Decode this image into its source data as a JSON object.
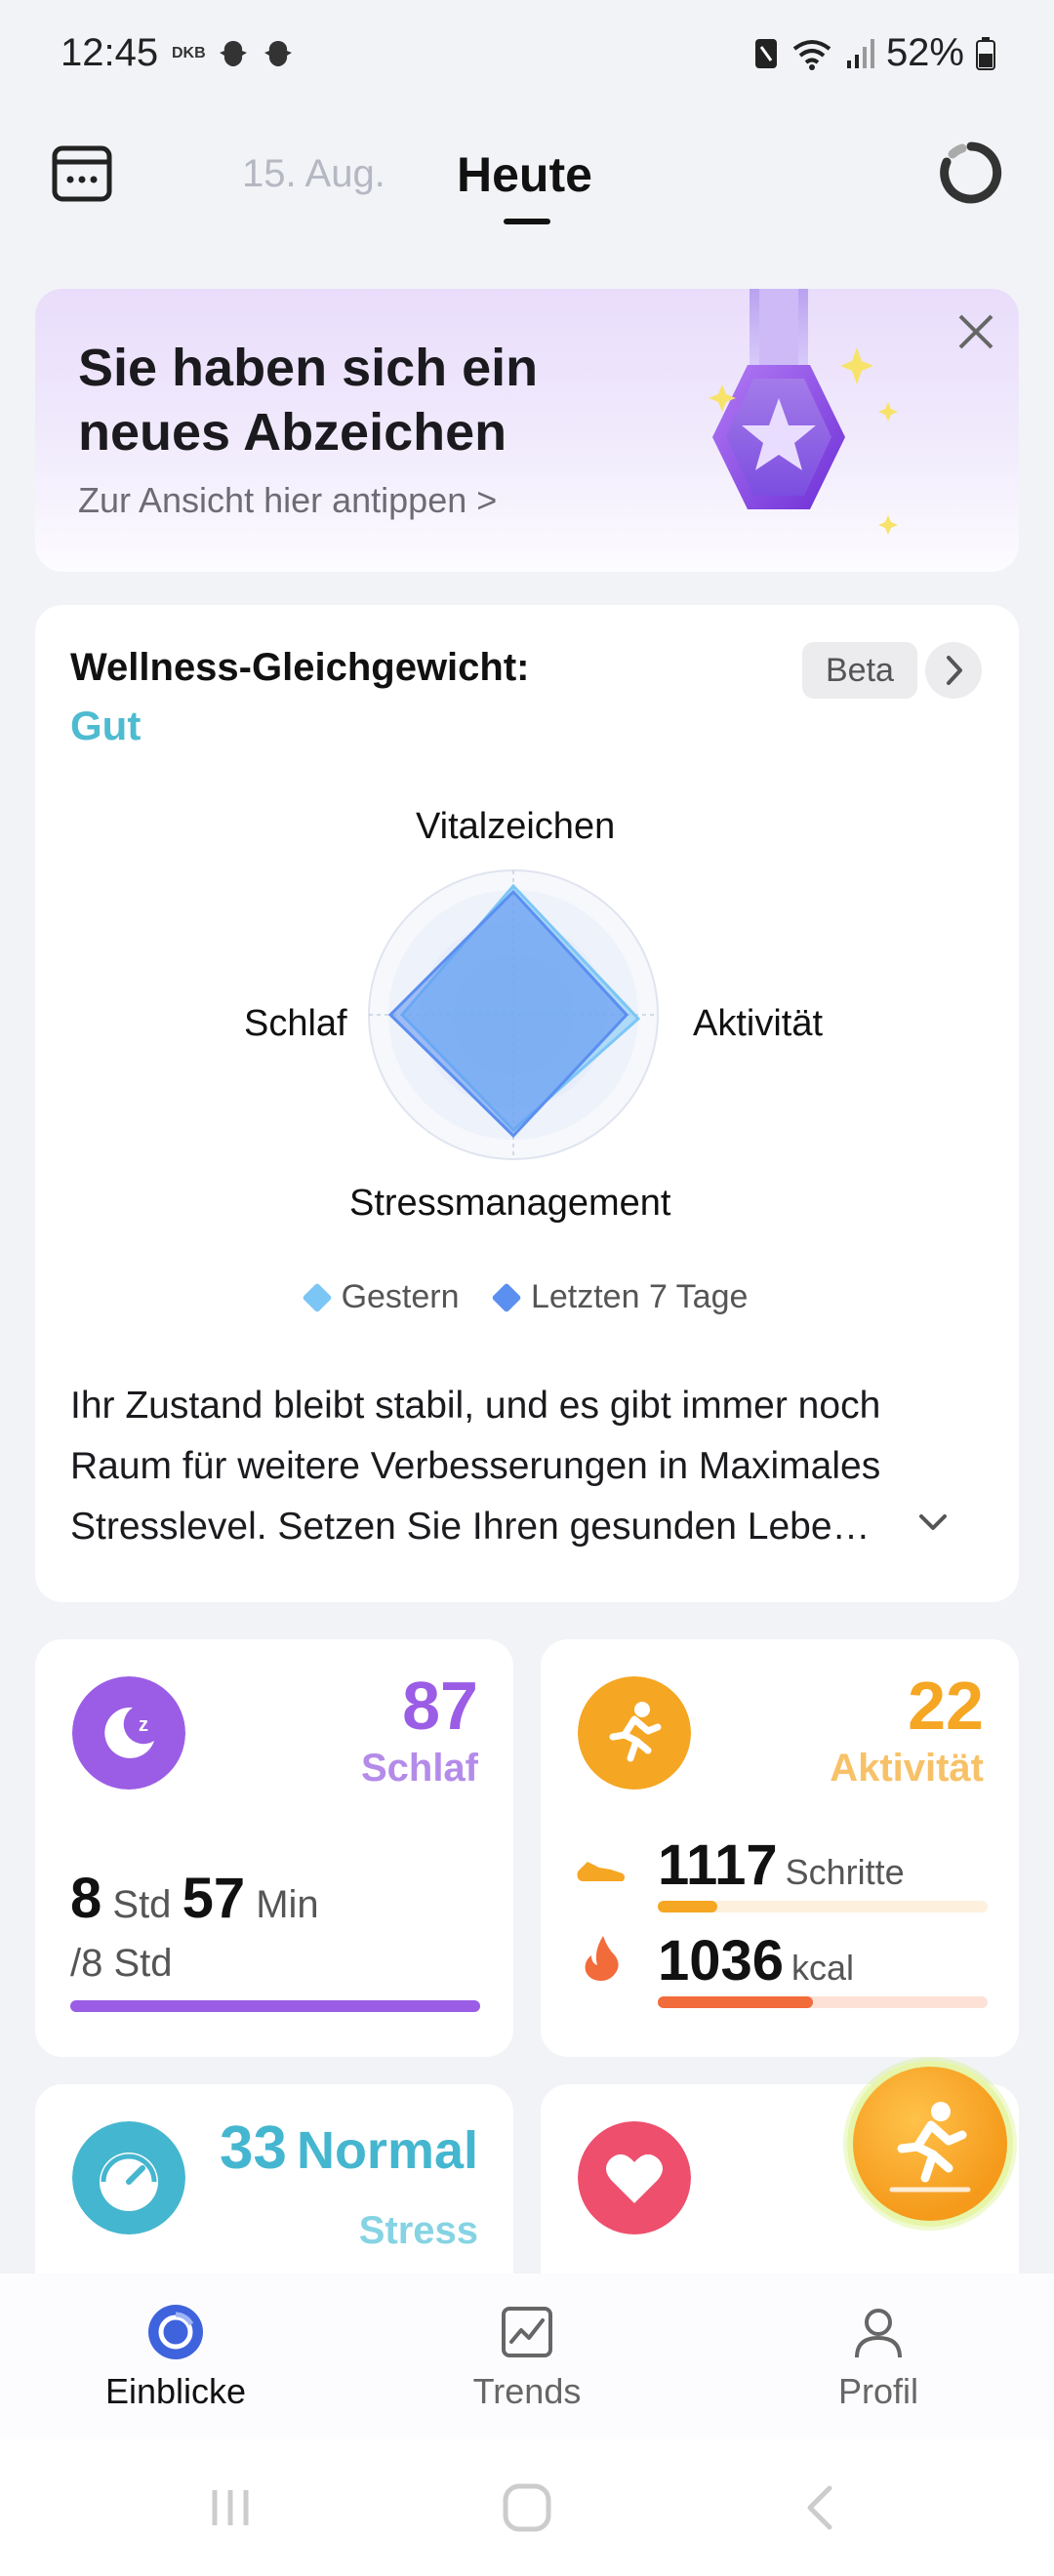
{
  "status_bar": {
    "time": "12:45",
    "carrier_tag": "DKB",
    "battery": "52%"
  },
  "header": {
    "previous_date": "15. Aug.",
    "current_date": "Heute"
  },
  "badge_banner": {
    "title": "Sie haben sich ein neues Abzeichen",
    "subtitle": "Zur Ansicht hier antippen",
    "chevron": ">"
  },
  "wellness": {
    "title": "Wellness-Gleichgewicht:",
    "rating": "Gut",
    "beta_label": "Beta",
    "axes": {
      "top": "Vitalzeichen",
      "right": "Aktivität",
      "bottom": "Stressmanagement",
      "left": "Schlaf"
    },
    "legend": [
      {
        "label": "Gestern",
        "color": "#7cc6f6"
      },
      {
        "label": "Letzten 7 Tage",
        "color": "#5b8ff0"
      }
    ],
    "description": "Ihr Zustand bleibt stabil, und es gibt immer noch Raum für weitere Verbesserungen in Maximales Stresslevel. Setzen Sie Ihren gesunden Lebe…"
  },
  "sleep": {
    "score": "87",
    "label": "Schlaf",
    "hours": "8",
    "hours_unit": "Std",
    "minutes": "57",
    "minutes_unit": "Min",
    "goal": "/8 Std",
    "progress": 1.0,
    "color": "#9b5de5"
  },
  "activity": {
    "score": "22",
    "label": "Aktivität",
    "steps": "1117",
    "steps_unit": "Schritte",
    "steps_progress": 0.18,
    "calories": "1036",
    "calories_unit": "kcal",
    "calories_progress": 0.47,
    "color": "#f5a623"
  },
  "stress": {
    "score": "33",
    "level": "Normal",
    "label": "Stress",
    "color": "#45b6cf"
  },
  "heart": {
    "color": "#ee4f6d"
  },
  "bottom_nav": {
    "items": [
      {
        "label": "Einblicke"
      },
      {
        "label": "Trends"
      },
      {
        "label": "Profil"
      }
    ]
  }
}
